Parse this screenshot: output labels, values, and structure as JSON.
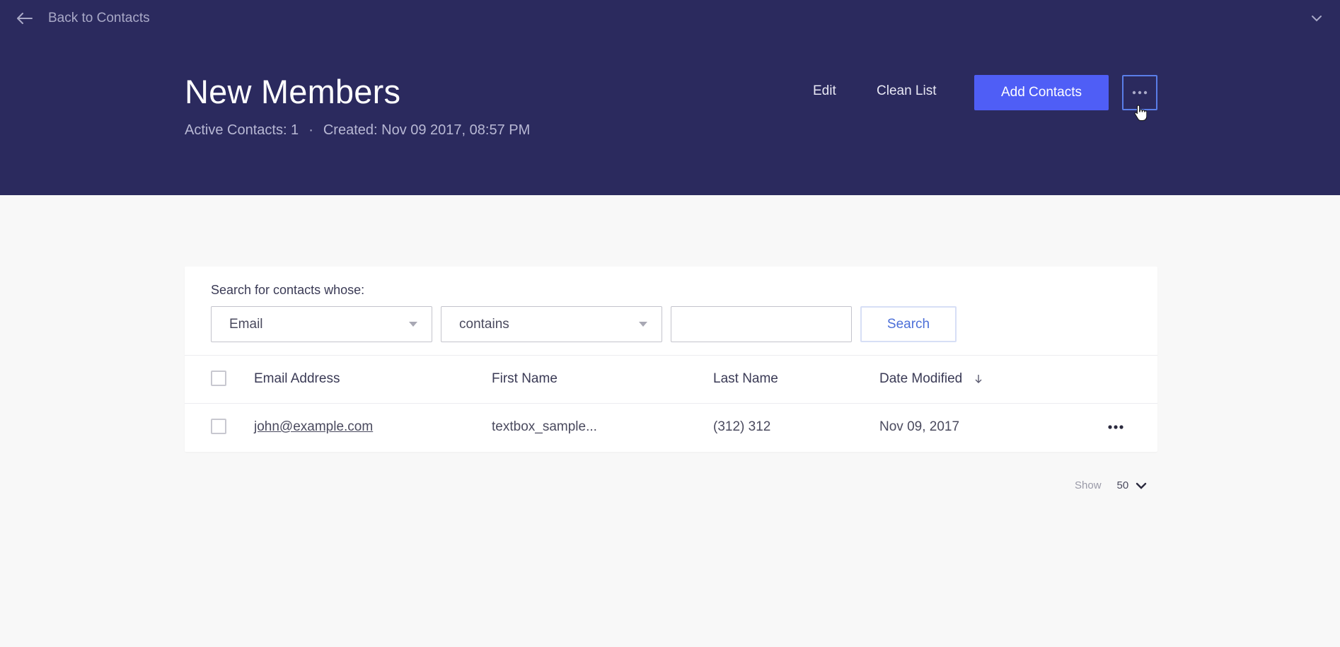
{
  "header": {
    "back_label": "Back to Contacts",
    "title": "New Members",
    "active_contacts": "Active Contacts: 1",
    "separator": "·",
    "created": "Created: Nov 09 2017, 08:57 PM",
    "edit_label": "Edit",
    "clean_label": "Clean List",
    "add_label": "Add Contacts",
    "bg_color": "#2b2a5e",
    "accent_color": "#4f5ef6"
  },
  "search": {
    "label": "Search for contacts whose:",
    "field_value": "Email",
    "operator_value": "contains",
    "query_value": "",
    "button_label": "Search"
  },
  "table": {
    "columns": [
      "Email Address",
      "First Name",
      "Last Name",
      "Date Modified"
    ],
    "rows": [
      {
        "email": "john@example.com",
        "first_name": "textbox_sample...",
        "last_name": "(312) 312",
        "date_modified": "Nov 09, 2017"
      }
    ]
  },
  "pager": {
    "show_label": "Show",
    "page_size": "50"
  }
}
